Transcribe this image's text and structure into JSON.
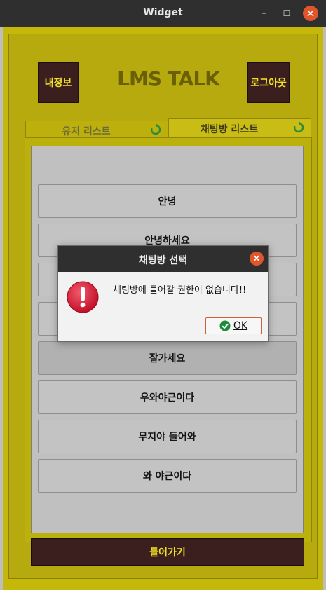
{
  "window": {
    "title": "Widget"
  },
  "header": {
    "my_info_label": "내정보",
    "app_title": "LMS TALK",
    "logout_label": "로그아웃"
  },
  "tabs": [
    {
      "label": "유저 리스트",
      "icon": "refresh-icon",
      "selected": false
    },
    {
      "label": "채팅방 리스트",
      "icon": "refresh-icon",
      "selected": true
    }
  ],
  "rooms": [
    {
      "name": "안녕"
    },
    {
      "name": "안녕하세요"
    },
    {
      "name": ""
    },
    {
      "name": ""
    },
    {
      "name": "잘가세요",
      "selected": true
    },
    {
      "name": "우와야근이다"
    },
    {
      "name": "무지야 들어와"
    },
    {
      "name": "와 야근이다"
    }
  ],
  "enter_button_label": "들어가기",
  "dialog": {
    "title": "채팅방 선택",
    "message": "채팅방에 들어갈 권한이 없습니다!!",
    "ok_label": "OK",
    "icon": "error-icon"
  },
  "colors": {
    "background_yellow": "#c6b80b",
    "button_dark": "#3b1e1e",
    "button_text": "#f0e22a",
    "titlebar": "#2f2f2f",
    "close_red": "#e0552b"
  }
}
